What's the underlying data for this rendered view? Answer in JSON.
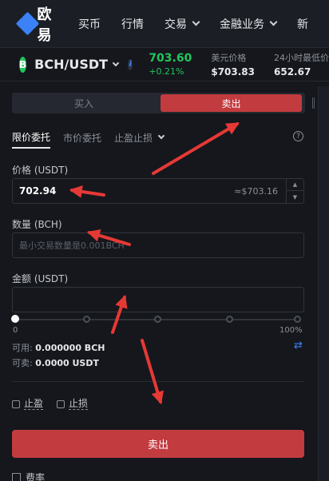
{
  "nav": {
    "brand": "欧易",
    "items": [
      {
        "label": "买币",
        "has_dropdown": false
      },
      {
        "label": "行情",
        "has_dropdown": false
      },
      {
        "label": "交易",
        "has_dropdown": true
      },
      {
        "label": "金融业务",
        "has_dropdown": true
      },
      {
        "label": "新",
        "has_dropdown": false
      }
    ]
  },
  "ticker": {
    "coin_symbol": "B",
    "pair": "BCH/USDT",
    "last_price": "703.60",
    "change": "+0.21%",
    "usd_label": "美元价格",
    "usd_value": "$703.83",
    "low_label": "24小时最低价",
    "low_value": "652.67"
  },
  "order": {
    "side_buy": "买入",
    "side_sell": "卖出",
    "tabs": [
      "限价委托",
      "市价委托",
      "止盈止损"
    ],
    "help": "?",
    "price_label": "价格 (USDT)",
    "price_value": "702.94",
    "price_hint": "≈$703.16",
    "qty_label": "数量 (BCH)",
    "qty_placeholder": "最小交易数量是0.001BCH",
    "amount_label": "金额 (USDT)",
    "amount_placeholder": "",
    "slider_min": "0",
    "slider_max": "100%",
    "slider_percent": 0,
    "avail_label": "可用:",
    "avail_value": "0.000000 BCH",
    "sellable_label": "可卖:",
    "sellable_value": "0.0000 USDT",
    "take_profit": "止盈",
    "stop_loss": "止损",
    "submit": "卖出",
    "fee": "费率"
  },
  "colors": {
    "sell": "#c23b3f",
    "up": "#22c55e",
    "accent": "#3b82f6",
    "annotation": "#e53935"
  }
}
